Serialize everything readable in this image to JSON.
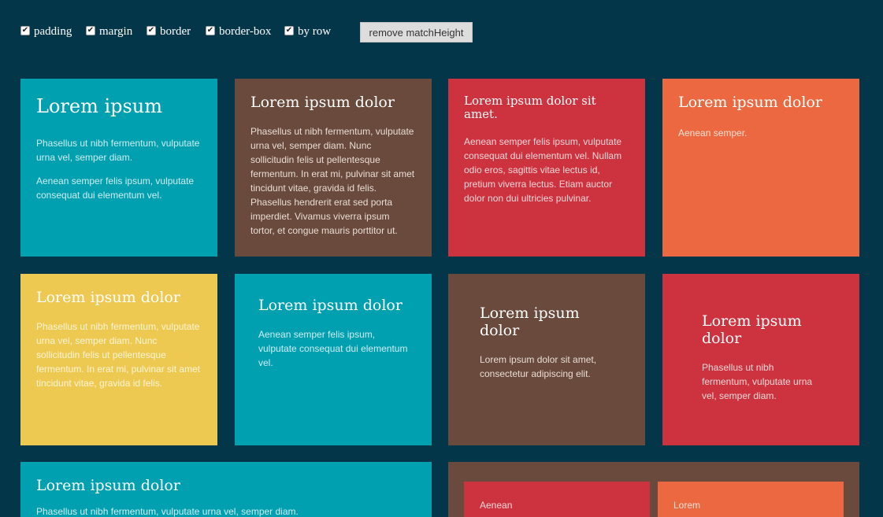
{
  "controls": {
    "checkboxes": [
      {
        "label": "padding",
        "checked": true
      },
      {
        "label": "margin",
        "checked": true
      },
      {
        "label": "border",
        "checked": true
      },
      {
        "label": "border-box",
        "checked": true
      },
      {
        "label": "by row",
        "checked": true
      }
    ],
    "check_glyph": "✔",
    "remove_button": "remove matchHeight"
  },
  "colors": {
    "background": "#04364a",
    "teal": "#00a0b0",
    "brown": "#6a4a3c",
    "red": "#cc333f",
    "orange": "#eb6841",
    "yellow": "#edc951"
  },
  "tiles": [
    {
      "title": "Lorem ipsum",
      "paragraphs": [
        "Phasellus ut nibh fermentum, vulputate urna vel, semper diam.",
        "Aenean semper felis ipsum, vulputate consequat dui elementum vel."
      ]
    },
    {
      "title": "Lorem ipsum dolor",
      "paragraphs": [
        "Phasellus ut nibh fermentum, vulputate urna vel, semper diam. Nunc sollicitudin felis ut pellentesque fermentum. In erat mi, pulvinar sit amet tincidunt vitae, gravida id felis. Phasellus hendrerit erat sed porta imperdiet. Vivamus viverra ipsum tortor, et congue mauris porttitor ut."
      ]
    },
    {
      "title": "Lorem ipsum dolor sit amet.",
      "paragraphs": [
        "Aenean semper felis ipsum, vulputate consequat dui elementum vel. Nullam odio eros, sagittis vitae lectus id, pretium viverra lectus. Etiam auctor dolor non dui ultricies pulvinar."
      ]
    },
    {
      "title": "Lorem ipsum dolor",
      "paragraphs": [
        "Aenean semper."
      ]
    },
    {
      "title": "Lorem ipsum dolor",
      "paragraphs": [
        "Phasellus ut nibh fermentum, vulputate urna vel, semper diam. Nunc sollicitudin felis ut pellentesque fermentum. In erat mi, pulvinar sit amet tincidunt vitae, gravida id felis."
      ]
    },
    {
      "title": "Lorem ipsum dolor",
      "paragraphs": [
        "Aenean semper felis ipsum, vulputate consequat dui elementum vel."
      ]
    },
    {
      "title": "Lorem ipsum dolor",
      "paragraphs": [
        "Lorem ipsum dolor sit amet, consectetur adipiscing elit."
      ]
    },
    {
      "title": "Lorem ipsum dolor",
      "paragraphs": [
        "Phasellus ut nibh fermentum, vulputate urna vel, semper diam."
      ]
    },
    {
      "title": "Lorem ipsum dolor",
      "paragraphs": [
        "Phasellus ut nibh fermentum, vulputate urna vel, semper diam."
      ]
    }
  ],
  "nested": [
    {
      "text": "Aenean"
    },
    {
      "text": "Lorem"
    }
  ]
}
